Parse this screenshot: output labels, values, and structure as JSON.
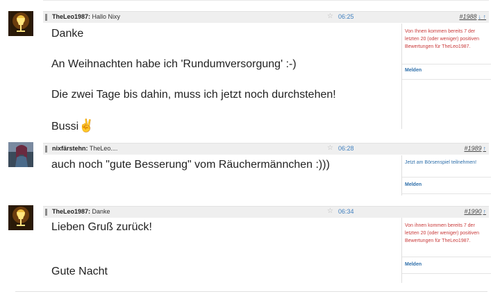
{
  "posts": [
    {
      "author": "TheLeo1987:",
      "subject": "Hallo Nixy",
      "time": "06:25",
      "number": "#1988",
      "arrows": "↓ ↑",
      "lines": [
        "Danke",
        "An Weihnachten habe ich 'Rundumversorgung' :-)",
        "Die zwei Tage bis dahin, muss ich jetzt noch durchstehen!",
        "Bussi"
      ],
      "emoji": "✌",
      "side_note": "Von Ihnen kommen bereits 7 der letzten 20 (oder weniger) positiven Bewertungen für TheLeo1987.",
      "melden": "Melden"
    },
    {
      "author": "nixfärstehn:",
      "subject": "TheLeo....",
      "time": "06:28",
      "number": "#1989",
      "arrows": "↑",
      "lines": [
        "auch noch \"gute Besserung\" vom Räuchermännchen    :)))"
      ],
      "side_note": "Jetzt am Börsenspiel teilnehmen!",
      "melden": "Melden"
    },
    {
      "author": "TheLeo1987:",
      "subject": "Danke",
      "time": "06:34",
      "number": "#1990",
      "arrows": "↑",
      "lines": [
        "Lieben Gruß zurück!",
        "Gute Nacht"
      ],
      "side_note": "Von ihnen kommen bereits 7 der letzten 20 (oder weniger) positiven Bewertungen für TheLeo1987.",
      "melden": "Melden"
    }
  ],
  "icons": {
    "star": "star-icon",
    "thread_arrows": "arrow-icon"
  },
  "colors": {
    "time": "#3f7fbf",
    "warning": "#c93a3a",
    "link": "#2e6faa",
    "header_bg": "#efefef"
  }
}
